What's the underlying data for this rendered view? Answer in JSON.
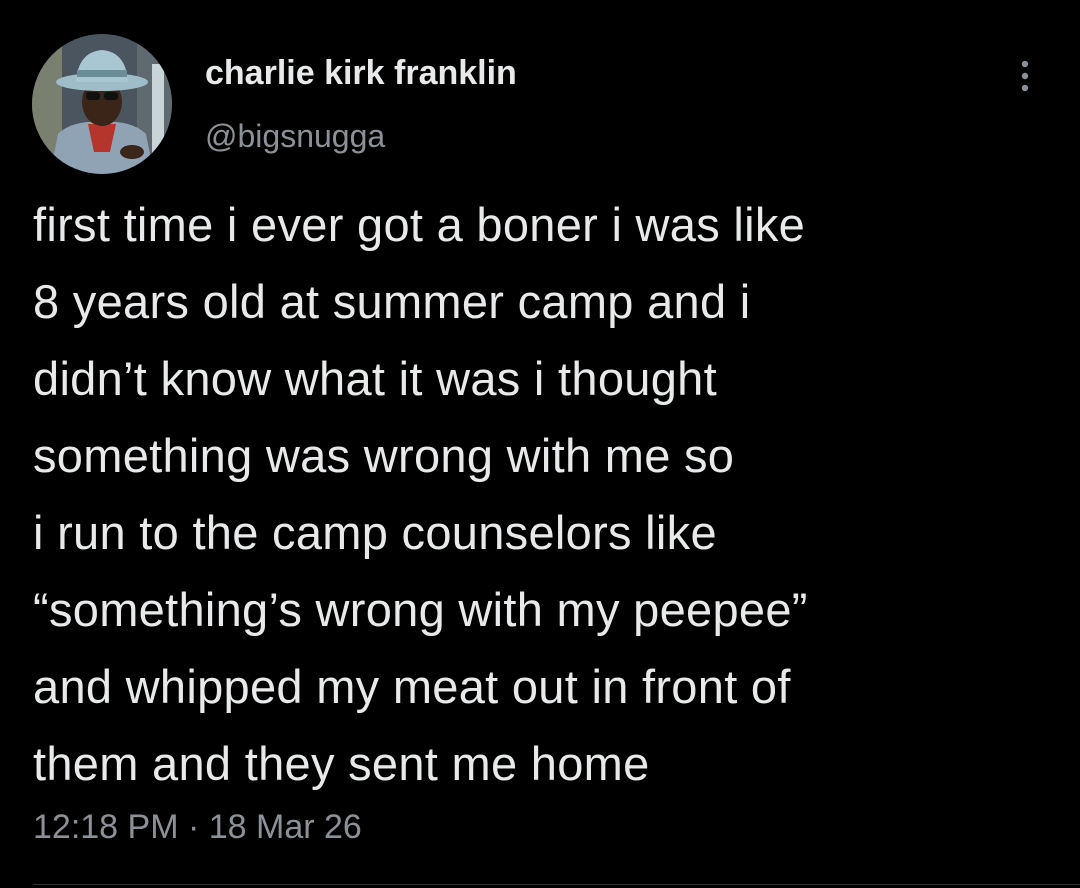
{
  "tweet": {
    "display_name": "charlie kirk franklin",
    "handle": "@bigsnugga",
    "text": "first time i ever got a boner i was like\n8 years old at summer camp and i\ndidn’t know what it was i thought\nsomething was wrong with me so\ni run to the camp counselors like\n“something’s wrong with my peepee”\nand whipped my meat out in front of\nthem and they sent me home",
    "time": "12:18 PM",
    "separator": " · ",
    "date": "18 Mar 26"
  },
  "icons": {
    "avatar": "profile-photo",
    "more": "more-options-icon"
  },
  "colors": {
    "background": "#000000",
    "primary_text": "#e7e9ea",
    "secondary_text": "#8b9197",
    "divider": "#2f3336"
  }
}
